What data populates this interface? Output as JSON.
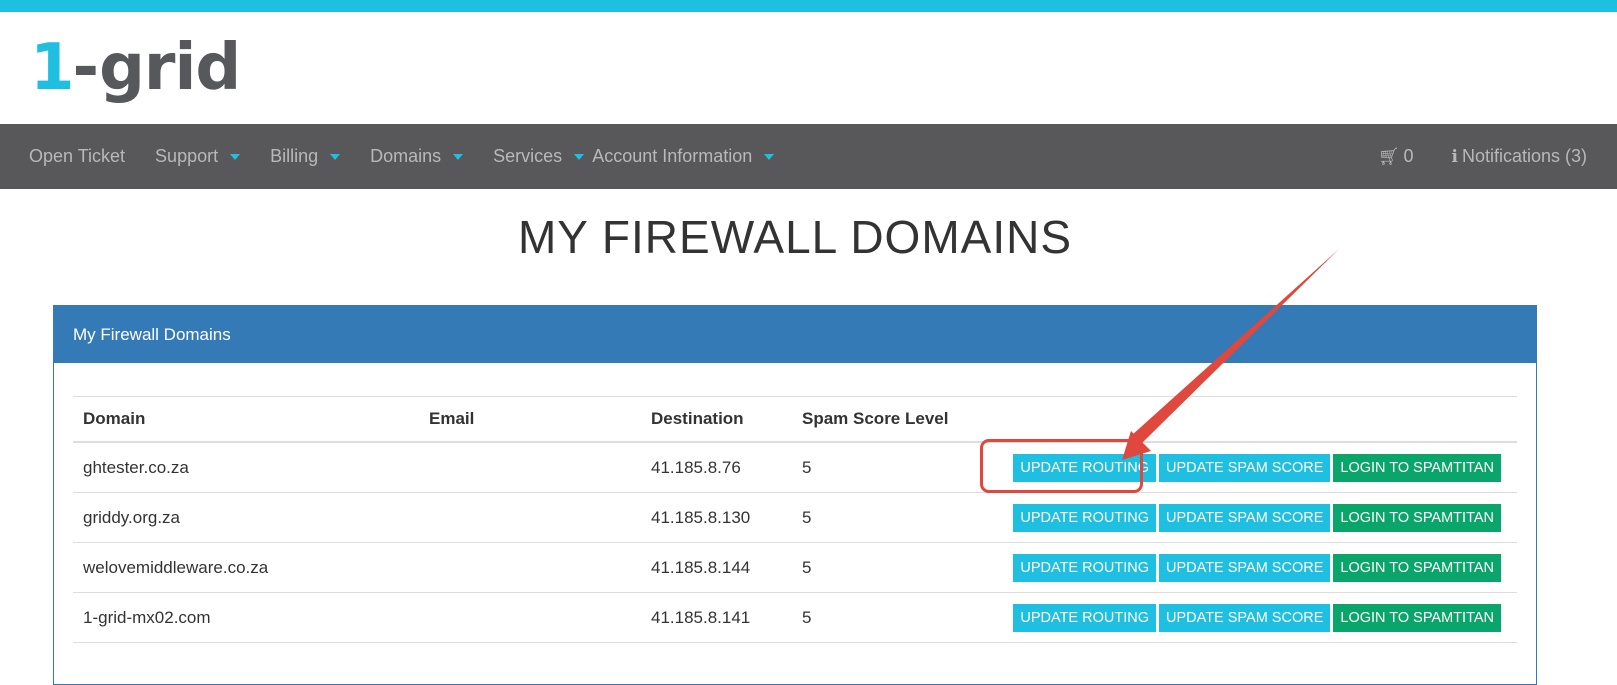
{
  "logo": {
    "num": "1",
    "dash": "-",
    "word": "grid"
  },
  "nav": {
    "items": [
      {
        "label": "Open Ticket",
        "dropdown": false
      },
      {
        "label": "Support",
        "dropdown": true
      },
      {
        "label": "Billing",
        "dropdown": true
      },
      {
        "label": "Domains",
        "dropdown": true
      },
      {
        "label": "Services",
        "dropdown": true
      },
      {
        "label": "Account Information",
        "dropdown": true
      }
    ],
    "cart_count": "0",
    "notifications_label": "Notifications (3)"
  },
  "page": {
    "title": "MY FIREWALL DOMAINS"
  },
  "panel": {
    "heading": "My Firewall Domains"
  },
  "table": {
    "headers": [
      "Domain",
      "Email",
      "Destination",
      "Spam Score Level"
    ],
    "rows": [
      {
        "domain": "ghtester.co.za",
        "email": "",
        "destination": "41.185.8.76",
        "spam": "5"
      },
      {
        "domain": "griddy.org.za",
        "email": "",
        "destination": "41.185.8.130",
        "spam": "5"
      },
      {
        "domain": "welovemiddleware.co.za",
        "email": "",
        "destination": "41.185.8.144",
        "spam": "5"
      },
      {
        "domain": "1-grid-mx02.com",
        "email": "",
        "destination": "41.185.8.141",
        "spam": "5"
      }
    ],
    "actions": {
      "update_routing": "UPDATE ROUTING",
      "update_spam": "UPDATE SPAM SCORE",
      "login_spamtitan": "LOGIN TO SPAMTITAN"
    }
  },
  "colors": {
    "brand": "#1ebfe0",
    "nav_bg": "#58585b",
    "panel": "#337ab7",
    "success": "#0aa56a",
    "annotation": "#e0473d"
  }
}
